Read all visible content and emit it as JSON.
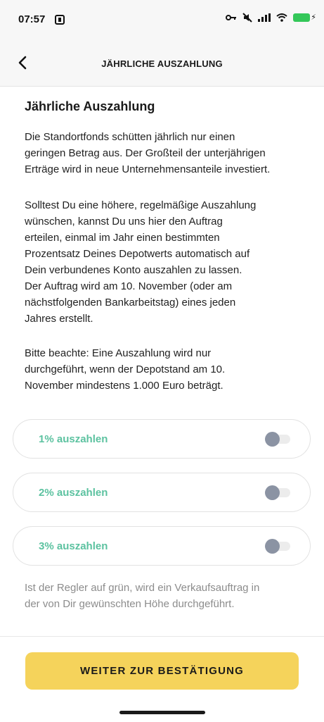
{
  "status_bar": {
    "time": "07:57",
    "icons": [
      "app-notification-icon",
      "key-icon",
      "mute-icon",
      "signal-icon",
      "wifi-icon",
      "battery-icon"
    ],
    "battery_color": "#34c759"
  },
  "nav": {
    "title": "JÄHRLICHE AUSZAHLUNG",
    "back_icon": "chevron-left-icon"
  },
  "content": {
    "heading": "Jährliche Auszahlung",
    "paragraph_1": "Die Standortfonds schütten jährlich nur einen\ngeringen Betrag aus. Der Großteil der unterjährigen\nErträge wird in neue Unternehmensanteile investiert.",
    "paragraph_2": "Solltest Du eine höhere, regelmäßige Auszahlung\nwünschen, kannst Du uns hier den Auftrag\nerteilen, einmal im Jahr einen bestimmten\nProzentsatz Deines Depotwerts automatisch auf\nDein verbundenes Konto auszahlen zu lassen.\nDer Auftrag wird am 10. November (oder am\nnächstfolgenden Bankarbeitstag) eines jeden\nJahres erstellt.",
    "paragraph_3": "Bitte beachte: Eine Auszahlung wird nur\ndurchgeführt, wenn der Depotstand am 10.\nNovember mindestens 1.000 Euro beträgt.",
    "options": [
      {
        "label": "1% auszahlen",
        "enabled": false
      },
      {
        "label": "2% auszahlen",
        "enabled": false
      },
      {
        "label": "3% auszahlen",
        "enabled": false
      }
    ],
    "hint": "Ist der Regler auf grün, wird ein Verkaufsauftrag in\nder von Dir gewünschten Höhe durchgeführt."
  },
  "footer": {
    "button_label": "WEITER ZUR BESTÄTIGUNG"
  },
  "colors": {
    "accent_green": "#5cc2a0",
    "button_yellow": "#f5d35b",
    "toggle_off_knob": "#8b93a3"
  }
}
